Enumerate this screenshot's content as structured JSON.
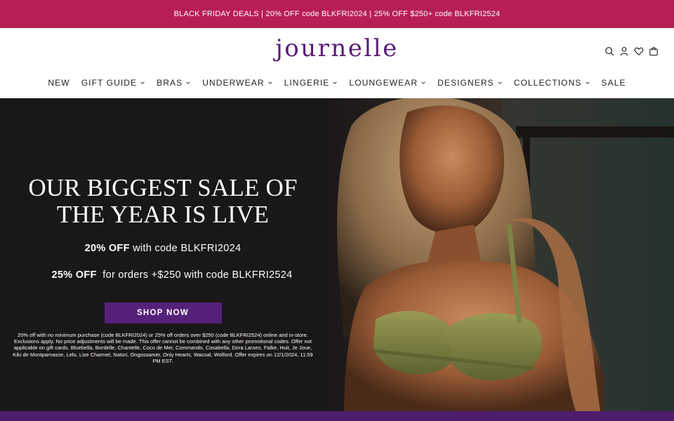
{
  "promo": {
    "text": "BLACK FRIDAY DEALS | 20% OFF code BLKFRI2024 | 25% OFF $250+ code BLKFRI2524"
  },
  "header": {
    "logo": "journelle",
    "icons": [
      "search-icon",
      "account-icon",
      "wishlist-icon",
      "cart-icon"
    ]
  },
  "nav": {
    "items": [
      {
        "label": "NEW",
        "has_dropdown": false
      },
      {
        "label": "GIFT GUIDE",
        "has_dropdown": true
      },
      {
        "label": "BRAS",
        "has_dropdown": true
      },
      {
        "label": "UNDERWEAR",
        "has_dropdown": true
      },
      {
        "label": "LINGERIE",
        "has_dropdown": true
      },
      {
        "label": "LOUNGEWEAR",
        "has_dropdown": true
      },
      {
        "label": "DESIGNERS",
        "has_dropdown": true
      },
      {
        "label": "COLLECTIONS",
        "has_dropdown": true
      },
      {
        "label": "SALE",
        "has_dropdown": false
      }
    ]
  },
  "hero": {
    "heading_line1": "OUR BIGGEST SALE OF",
    "heading_line2": "THE YEAR IS LIVE",
    "offer1_bold": "20% OFF",
    "offer1_rest": " with code BLKFRI2024",
    "offer2_bold": "25% OFF",
    "offer2_rest": "  for orders +$250 with code BLKFRI2524",
    "cta": "SHOP NOW",
    "fine_print": "20% off with no minimum purchase (code BLKFRI2024) or 25% off orders over $250 (code BLKFRI2524) online and in-store. Exclusions apply. No price adjustments will be made. This offer cannot be combined with any other promotional codes. Offer not applicable on gift cards, Bluebella, Bordelle, Chantelle, Coco de Mer, Commando, Cosabella, Dora Larsen, Falke, Huit, Je Joue, Kiki de Montparnasse, Lelo, Lise Charmel, Natori, Ongossamer, Only Hearts, Wacoal, Wolford. Offer expires on 12/1/2024, 11:59 PM EST."
  },
  "colors": {
    "promo_bg": "#b81e56",
    "brand_purple": "#5a1a78",
    "button_bg": "#55207a",
    "hero_bg": "#1a1719"
  }
}
